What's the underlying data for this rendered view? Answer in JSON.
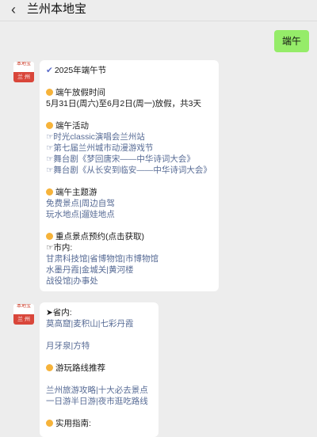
{
  "header": {
    "back_label": "‹",
    "title": "兰州本地宝"
  },
  "user_message": {
    "text": "端午"
  },
  "avatar": {
    "top_text": "本地宝",
    "bottom_text": "兰 州"
  },
  "message1": {
    "title": "2025年端午节",
    "holiday_heading": "端午放假时间",
    "holiday_text": "5月31日(周六)至6月2日(周一)放假，共3天",
    "activities_heading": "端午活动",
    "activities": [
      "☞时光classic演唱会兰州站",
      "☞第七届兰州城市动漫游戏节",
      "☞舞台剧《梦回唐宋——中华诗词大会》",
      "☞舞台剧《从长安到临安——中华诗词大会》"
    ],
    "themes_heading": "端午主题游",
    "themes_line1": [
      "免费景点",
      "|",
      "周边自驾"
    ],
    "themes_line2": [
      "玩水地点",
      "|",
      "遛娃地点"
    ],
    "booking_heading": "重点景点预约(点击获取)",
    "city_label": "☞市内:",
    "city_line1": [
      "甘肃科技馆",
      "|",
      "省博物馆",
      "|",
      "市博物馆"
    ],
    "city_line2": [
      "水墨丹霞",
      "|",
      "金城关",
      "|",
      "黄河楼"
    ],
    "city_line3": [
      "战役馆",
      "|",
      "办事处"
    ]
  },
  "message2": {
    "province_label": "➤省内:",
    "province_line1": [
      "莫高窟",
      "|",
      "麦积山",
      "|",
      "七彩丹霞"
    ],
    "province_line2": [
      "月牙泉",
      "|",
      "方特"
    ],
    "routes_heading": "游玩路线推荐",
    "routes_line1": [
      "兰州旅游攻略",
      "|",
      "十大必去景点"
    ],
    "routes_line2": [
      "一日游半日游",
      "|",
      "夜市逛吃路线"
    ],
    "practical_heading": "实用指南:"
  },
  "colors": {
    "bubble_user": "#95ec69",
    "link": "#576b95",
    "dot": "#f6b33a",
    "background": "#ededed"
  }
}
